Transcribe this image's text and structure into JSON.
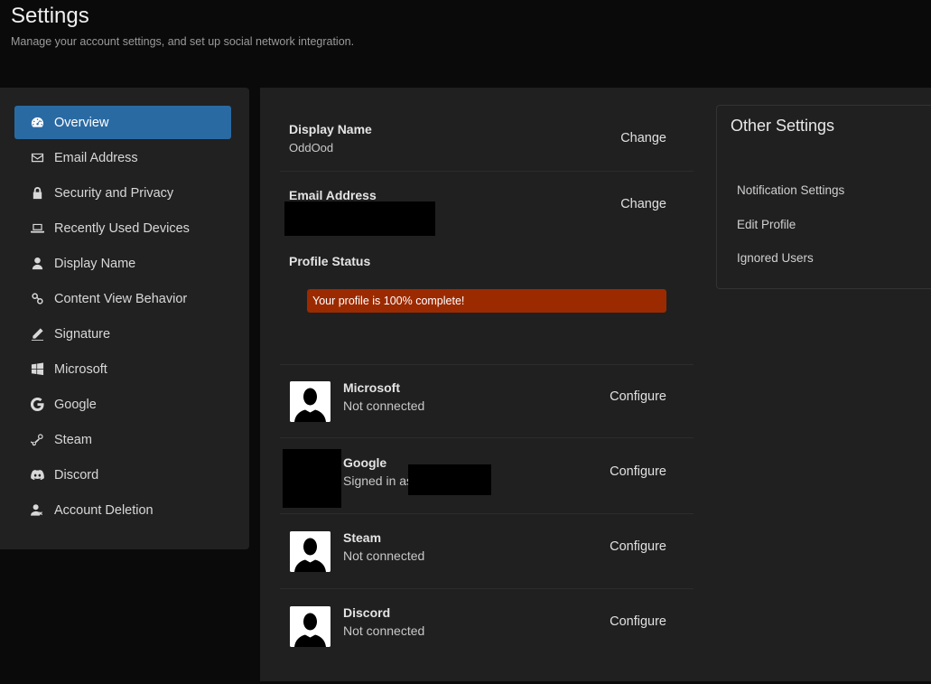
{
  "header": {
    "title": "Settings",
    "subtitle": "Manage your account settings, and set up social network integration."
  },
  "sidebar": {
    "items": [
      {
        "label": "Overview",
        "icon": "dashboard-icon",
        "active": true
      },
      {
        "label": "Email Address",
        "icon": "envelope-icon"
      },
      {
        "label": "Security and Privacy",
        "icon": "lock-icon"
      },
      {
        "label": "Recently Used Devices",
        "icon": "laptop-icon"
      },
      {
        "label": "Display Name",
        "icon": "user-icon"
      },
      {
        "label": "Content View Behavior",
        "icon": "link-icon"
      },
      {
        "label": "Signature",
        "icon": "pencil-icon"
      },
      {
        "label": "Microsoft",
        "icon": "windows-icon"
      },
      {
        "label": "Google",
        "icon": "google-icon"
      },
      {
        "label": "Steam",
        "icon": "steam-icon"
      },
      {
        "label": "Discord",
        "icon": "discord-icon"
      },
      {
        "label": "Account Deletion",
        "icon": "user-delete-icon"
      }
    ]
  },
  "overview": {
    "display_name": {
      "label": "Display Name",
      "value": "OddOod",
      "action": "Change"
    },
    "email": {
      "label": "Email Address",
      "action": "Change"
    },
    "profile_status": {
      "label": "Profile Status",
      "progress_text": "Your profile is 100% complete!",
      "progress": 100
    }
  },
  "connections": [
    {
      "name": "Microsoft",
      "status": "Not connected",
      "action": "Configure"
    },
    {
      "name": "Google",
      "status": "Signed in as",
      "action": "Configure"
    },
    {
      "name": "Steam",
      "status": "Not connected",
      "action": "Configure"
    },
    {
      "name": "Discord",
      "status": "Not connected",
      "action": "Configure"
    }
  ],
  "other_settings": {
    "title": "Other Settings",
    "links": [
      "Notification Settings",
      "Edit Profile",
      "Ignored Users"
    ]
  },
  "colors": {
    "accent": "#2a6aa3",
    "progress": "#9b2a00",
    "background": "#0a0a0a",
    "panel": "#202020"
  }
}
